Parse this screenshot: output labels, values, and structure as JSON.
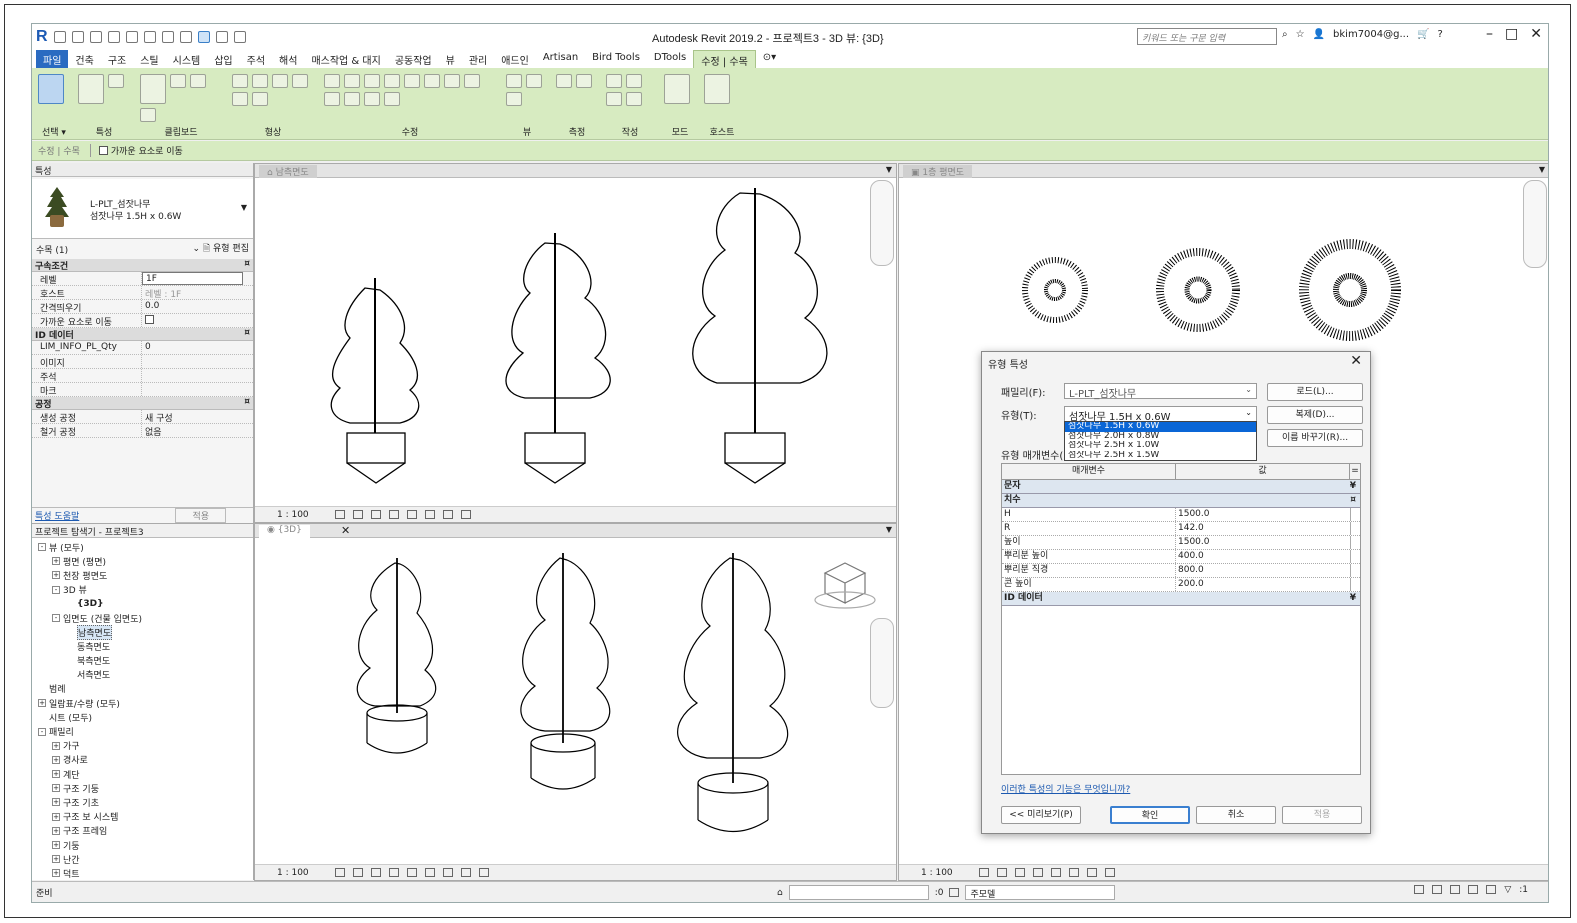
{
  "app": {
    "title": "Autodesk Revit 2019.2 - 프로젝트3 - 3D 뷰: {3D}",
    "search_placeholder": "키워드 또는 구문 입력",
    "user": "bkim7004@g...",
    "logo_letter": "R"
  },
  "ribbon": {
    "tabs": [
      "파일",
      "건축",
      "구조",
      "스틸",
      "시스템",
      "삽입",
      "주석",
      "해석",
      "매스작업 & 대지",
      "공동작업",
      "뷰",
      "관리",
      "애드인",
      "Artisan",
      "Bird Tools",
      "DTools",
      "수정 | 수목"
    ],
    "active_tab_index": 16,
    "groups": [
      {
        "label": "선택 ▾"
      },
      {
        "label": "특성"
      },
      {
        "label": "클립보드"
      },
      {
        "label": "형상"
      },
      {
        "label": "수정"
      },
      {
        "label": "뷰"
      },
      {
        "label": "측정"
      },
      {
        "label": "작성"
      },
      {
        "label": "모드"
      },
      {
        "label": "호스트"
      }
    ]
  },
  "options_bar": {
    "context": "수정 | 수목",
    "checkbox_label": "가까운 요소로 이동"
  },
  "properties": {
    "title": "특성",
    "family": "L-PLT_섬잣나무",
    "type": "섬잣나무 1.5H x 0.6W",
    "instance_filter": "수목 (1)",
    "edit_type": "유형 편집",
    "sections": [
      {
        "name": "구속조건",
        "rows": [
          {
            "key": "레벨",
            "value": "1F"
          },
          {
            "key": "호스트",
            "value": "레벨 : 1F"
          },
          {
            "key": "간격띄우기",
            "value": "0.0"
          },
          {
            "key": "가까운 요소로 이동",
            "value": ""
          }
        ]
      },
      {
        "name": "ID 데이터",
        "rows": [
          {
            "key": "LIM_INFO_PL_Qty",
            "value": "0"
          },
          {
            "key": "이미지",
            "value": ""
          },
          {
            "key": "주석",
            "value": ""
          },
          {
            "key": "마크",
            "value": ""
          }
        ]
      },
      {
        "name": "공정",
        "rows": [
          {
            "key": "생성 공정",
            "value": "새 구성"
          },
          {
            "key": "철거 공정",
            "value": "없음"
          }
        ]
      }
    ],
    "help_link": "특성 도움말",
    "apply": "적용"
  },
  "browser": {
    "title": "프로젝트 탐색기 - 프로젝트3",
    "nodes": [
      {
        "label": "뷰 (모두)",
        "depth": 0,
        "exp": "-"
      },
      {
        "label": "평면 (평면)",
        "depth": 1,
        "exp": "+"
      },
      {
        "label": "천장 평면도",
        "depth": 1,
        "exp": "+"
      },
      {
        "label": "3D 뷰",
        "depth": 1,
        "exp": "-"
      },
      {
        "label": "{3D}",
        "depth": 2,
        "exp": "",
        "bold": true
      },
      {
        "label": "입면도 (건물 입면도)",
        "depth": 1,
        "exp": "-"
      },
      {
        "label": "남측면도",
        "depth": 2,
        "exp": "",
        "sel": true
      },
      {
        "label": "동측면도",
        "depth": 2,
        "exp": ""
      },
      {
        "label": "북측면도",
        "depth": 2,
        "exp": ""
      },
      {
        "label": "서측면도",
        "depth": 2,
        "exp": ""
      },
      {
        "label": "범례",
        "depth": 0,
        "exp": ""
      },
      {
        "label": "일람표/수량 (모두)",
        "depth": 0,
        "exp": "+"
      },
      {
        "label": "시트 (모두)",
        "depth": 0,
        "exp": ""
      },
      {
        "label": "패밀리",
        "depth": 0,
        "exp": "-"
      },
      {
        "label": "가구",
        "depth": 1,
        "exp": "+"
      },
      {
        "label": "경사로",
        "depth": 1,
        "exp": "+"
      },
      {
        "label": "계단",
        "depth": 1,
        "exp": "+"
      },
      {
        "label": "구조 기둥",
        "depth": 1,
        "exp": "+"
      },
      {
        "label": "구조 기초",
        "depth": 1,
        "exp": "+"
      },
      {
        "label": "구조 보 시스템",
        "depth": 1,
        "exp": "+"
      },
      {
        "label": "구조 프레임",
        "depth": 1,
        "exp": "+"
      },
      {
        "label": "기둥",
        "depth": 1,
        "exp": "+"
      },
      {
        "label": "난간",
        "depth": 1,
        "exp": "+"
      },
      {
        "label": "덕트",
        "depth": 1,
        "exp": "+"
      }
    ]
  },
  "views": {
    "south": {
      "tab": "남측면도",
      "scale": "1 : 100"
    },
    "threed": {
      "tab": "{3D}",
      "scale": "1 : 100"
    },
    "plan": {
      "tab": "1층 평면도",
      "scale": "1 : 100"
    }
  },
  "dialog": {
    "title": "유형 특성",
    "family_label": "패밀리(F):",
    "family_value": "L-PLT_섬잣나무",
    "type_label": "유형(T):",
    "type_value": "섬잣나무 1.5H x 0.6W",
    "type_options": [
      "섬잣나무 1.5H x 0.6W",
      "섬잣나무 2.0H x 0.8W",
      "섬잣나무 2.5H x 1.0W",
      "섬잣나무 2.5H x 1.5W"
    ],
    "params_label": "유형 매개변수(",
    "load_btn": "로드(L)...",
    "dup_btn": "복제(D)...",
    "rename_btn": "이름 바꾸기(R)...",
    "col_param": "매개변수",
    "col_value": "값",
    "sections": [
      {
        "name": "문자",
        "toggle": "¥",
        "rows": []
      },
      {
        "name": "치수",
        "toggle": "¤",
        "rows": [
          {
            "key": "H",
            "value": "1500.0"
          },
          {
            "key": "R",
            "value": "142.0"
          },
          {
            "key": "높이",
            "value": "1500.0"
          },
          {
            "key": "뿌리분 높이",
            "value": "400.0"
          },
          {
            "key": "뿌리분 직경",
            "value": "800.0"
          },
          {
            "key": "콘 높이",
            "value": "200.0"
          }
        ]
      },
      {
        "name": "ID 데이터",
        "toggle": "¥",
        "rows": []
      }
    ],
    "help_link": "이러한 특성의 기능은 무엇입니까?",
    "preview_btn": "<< 미리보기(P)",
    "ok_btn": "확인",
    "cancel_btn": "취소",
    "apply_btn": "적용"
  },
  "status": {
    "text": "준비",
    "zero": ":0",
    "model": "주모델",
    "filter": ":1"
  }
}
